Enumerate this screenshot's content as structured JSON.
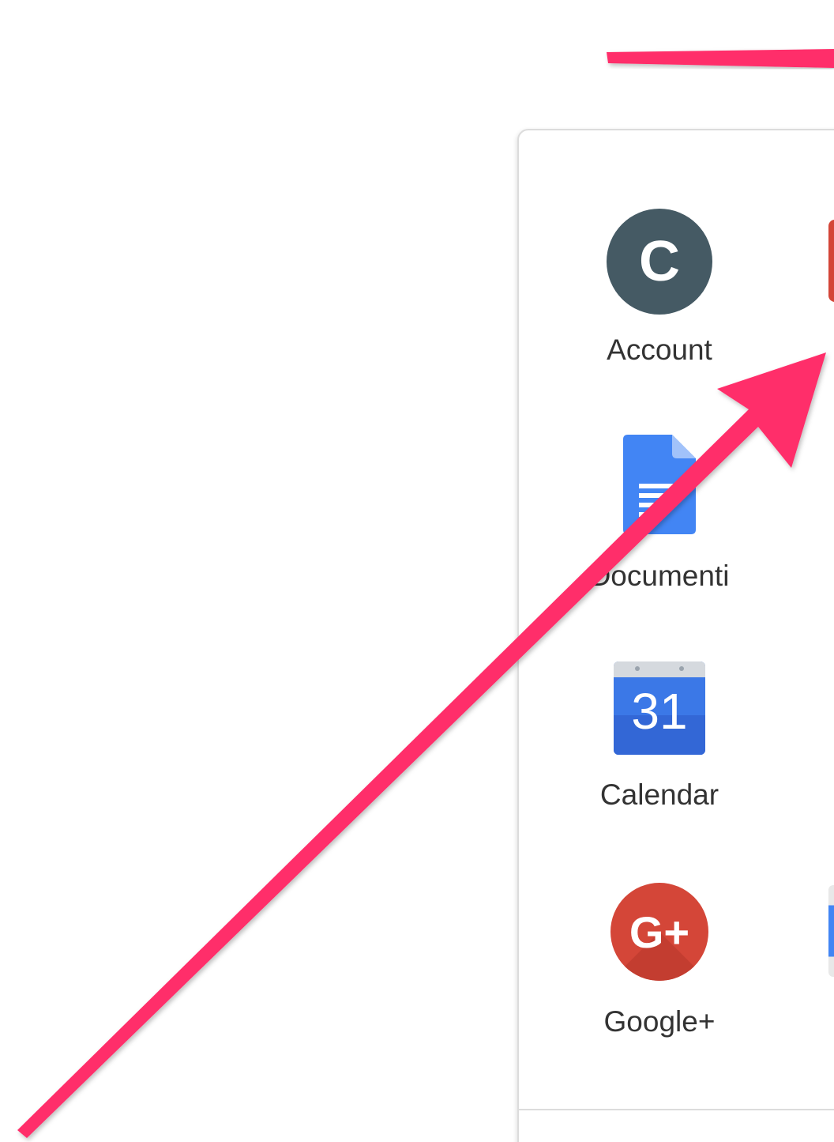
{
  "launcher": {
    "apps": [
      {
        "label": "Account",
        "icon": "account-avatar-icon",
        "avatar_letter": "C"
      },
      {
        "label": "Documenti",
        "icon": "docs-icon"
      },
      {
        "label": "Calendar",
        "icon": "calendar-icon",
        "calendar_day": "31"
      },
      {
        "label": "Google+",
        "icon": "google-plus-icon",
        "glyph": "G+"
      }
    ],
    "partial_column_icons": [
      "partially-visible-app-icon-red",
      "partially-visible-app-icon-blue"
    ]
  },
  "annotation": {
    "arrow_color": "#ff2e6a"
  },
  "colors": {
    "avatar_bg": "#455a64",
    "docs_blue": "#4285f4",
    "calendar_blue": "#3b78e7",
    "gplus_red": "#d44638"
  }
}
